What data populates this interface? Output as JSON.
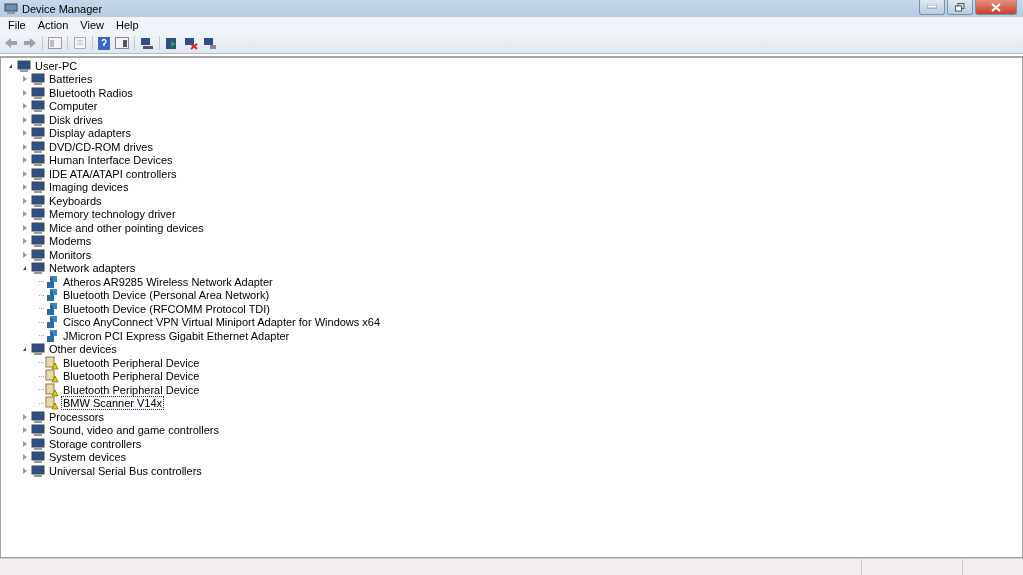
{
  "window": {
    "title": "Device Manager"
  },
  "menu": [
    "File",
    "Action",
    "View",
    "Help"
  ],
  "tree": {
    "label": "User-PC",
    "expanded": true,
    "selected": false,
    "children": [
      {
        "label": "Batteries",
        "expanded": false,
        "selected": false
      },
      {
        "label": "Bluetooth Radios",
        "expanded": false,
        "selected": false
      },
      {
        "label": "Computer",
        "expanded": false,
        "selected": false
      },
      {
        "label": "Disk drives",
        "expanded": false,
        "selected": false
      },
      {
        "label": "Display adapters",
        "expanded": false,
        "selected": false
      },
      {
        "label": "DVD/CD-ROM drives",
        "expanded": false,
        "selected": false
      },
      {
        "label": "Human Interface Devices",
        "expanded": false,
        "selected": false
      },
      {
        "label": "IDE ATA/ATAPI controllers",
        "expanded": false,
        "selected": false
      },
      {
        "label": "Imaging devices",
        "expanded": false,
        "selected": false
      },
      {
        "label": "Keyboards",
        "expanded": false,
        "selected": false
      },
      {
        "label": "Memory technology driver",
        "expanded": false,
        "selected": false
      },
      {
        "label": "Mice and other pointing devices",
        "expanded": false,
        "selected": false
      },
      {
        "label": "Modems",
        "expanded": false,
        "selected": false
      },
      {
        "label": "Monitors",
        "expanded": false,
        "selected": false
      },
      {
        "label": "Network adapters",
        "expanded": true,
        "selected": false,
        "children": [
          {
            "label": "Atheros AR9285 Wireless Network Adapter",
            "selected": false,
            "warning": false
          },
          {
            "label": "Bluetooth Device (Personal Area Network)",
            "selected": false,
            "warning": false
          },
          {
            "label": "Bluetooth Device (RFCOMM Protocol TDI)",
            "selected": false,
            "warning": false
          },
          {
            "label": "Cisco AnyConnect VPN Virtual Miniport Adapter for Windows x64",
            "selected": false,
            "warning": false
          },
          {
            "label": "JMicron PCI Express Gigabit Ethernet Adapter",
            "selected": false,
            "warning": false
          }
        ]
      },
      {
        "label": "Other devices",
        "expanded": true,
        "selected": false,
        "children": [
          {
            "label": "Bluetooth Peripheral Device",
            "selected": false,
            "warning": true
          },
          {
            "label": "Bluetooth Peripheral Device",
            "selected": false,
            "warning": true
          },
          {
            "label": "Bluetooth Peripheral Device",
            "selected": false,
            "warning": true
          },
          {
            "label": "BMW Scanner V14x",
            "selected": true,
            "warning": true
          }
        ]
      },
      {
        "label": "Processors",
        "expanded": false,
        "selected": false
      },
      {
        "label": "Sound, video and game controllers",
        "expanded": false,
        "selected": false
      },
      {
        "label": "Storage controllers",
        "expanded": false,
        "selected": false
      },
      {
        "label": "System devices",
        "expanded": false,
        "selected": false
      },
      {
        "label": "Universal Serial Bus controllers",
        "expanded": false,
        "selected": false
      }
    ]
  }
}
